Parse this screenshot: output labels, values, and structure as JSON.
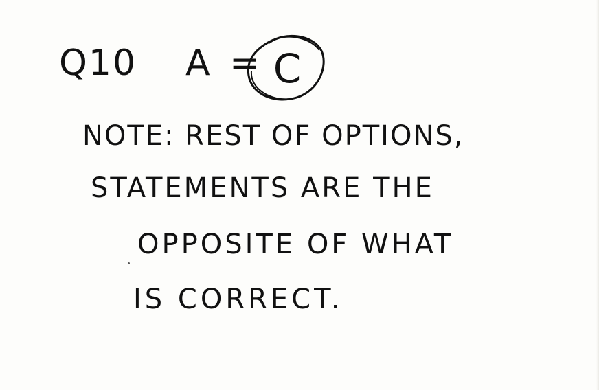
{
  "note": {
    "question_label": "Q10",
    "answer_prefix": "A =",
    "answer_value": "C",
    "lines": [
      "NOTE: REST OF OPTIONS,",
      "STATEMENTS ARE THE",
      "OPPOSITE OF WHAT",
      "IS CORRECT."
    ]
  },
  "colors": {
    "paper": "#fdfdfb",
    "ink": "#111111"
  }
}
